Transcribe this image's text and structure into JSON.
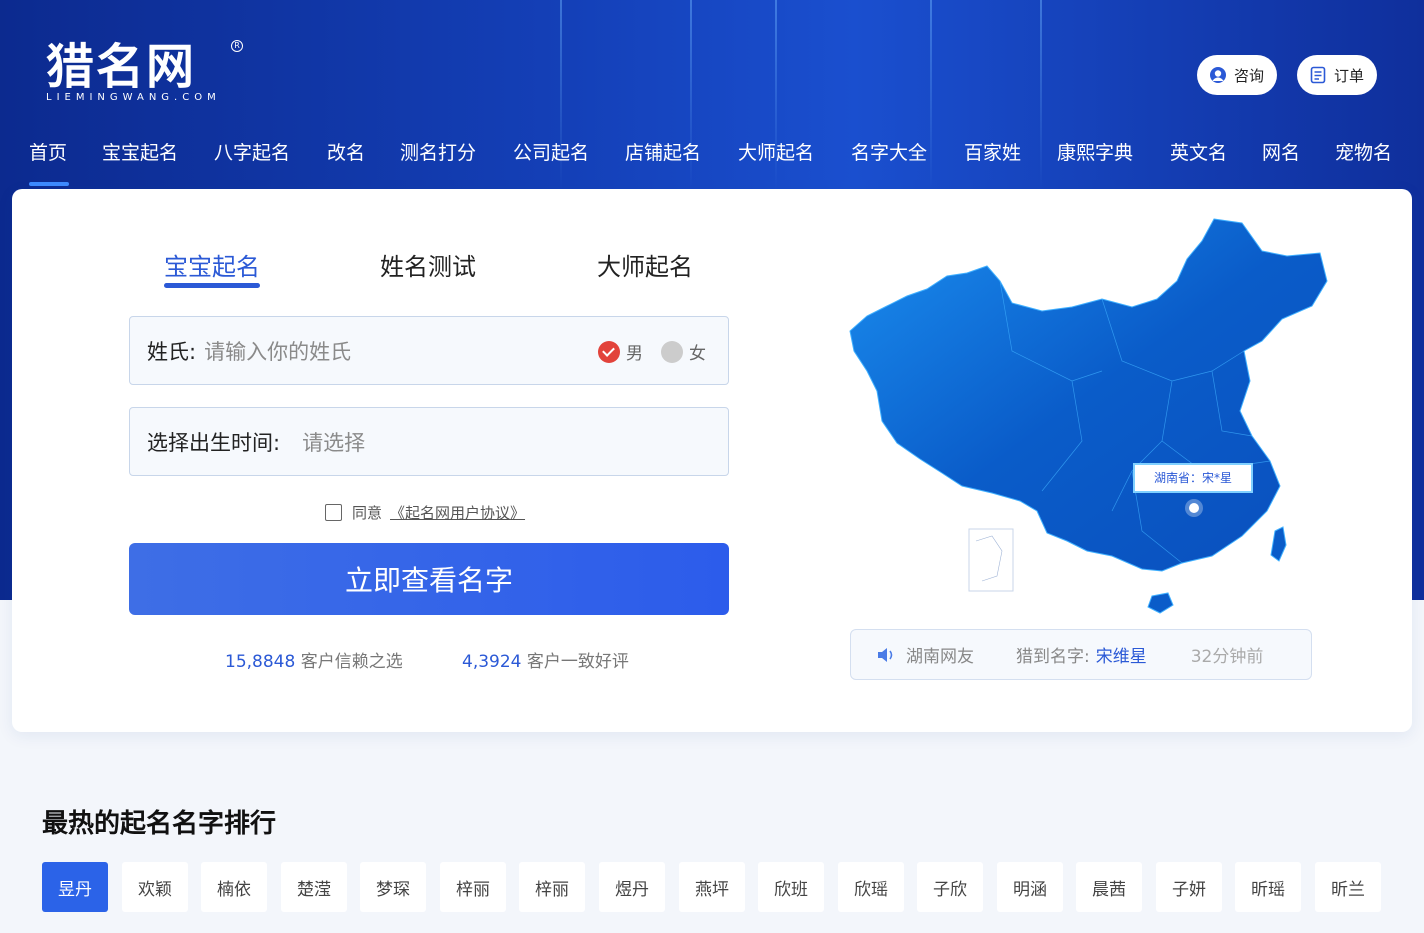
{
  "header": {
    "logo_text": "猎名网",
    "logo_sub": "LIEMINGWANG.COM",
    "consult_label": "咨询",
    "order_label": "订单"
  },
  "nav": {
    "items": [
      "首页",
      "宝宝起名",
      "八字起名",
      "改名",
      "测名打分",
      "公司起名",
      "店铺起名",
      "大师起名",
      "名字大全",
      "百家姓",
      "康熙字典",
      "英文名",
      "网名",
      "宠物名"
    ],
    "active": "首页"
  },
  "form": {
    "tabs": [
      "宝宝起名",
      "姓名测试",
      "大师起名"
    ],
    "active_tab": "宝宝起名",
    "surname_label": "姓氏:",
    "surname_placeholder": "请输入你的姓氏",
    "gender_male": "男",
    "gender_female": "女",
    "selected_gender": "男",
    "birth_label": "选择出生时间:",
    "birth_placeholder": "请选择",
    "agree_text": "同意",
    "agree_link": "《起名网用户协议》",
    "agreed": false,
    "submit_label": "立即查看名字",
    "stat1_num": "15,8848",
    "stat1_text": "客户信赖之选",
    "stat2_num": "4,3924",
    "stat2_text": "客户一致好评"
  },
  "map": {
    "popup": "湖南省：宋*星",
    "ticker_user": "湖南网友",
    "ticker_label": "猎到名字:",
    "ticker_name": "宋维星",
    "ticker_time": "32分钟前"
  },
  "ranking": {
    "title": "最热的起名名字排行",
    "names": [
      "昱丹",
      "欢颖",
      "楠依",
      "楚滢",
      "梦琛",
      "梓丽",
      "梓丽",
      "煜丹",
      "燕坪",
      "欣班",
      "欣瑶",
      "子欣",
      "明涵",
      "晨茜",
      "子妍",
      "昕瑶",
      "昕兰"
    ],
    "active": "昱丹"
  },
  "colors": {
    "primary": "#2b59d6",
    "hero_dark": "#0c2a8f",
    "accent_red": "#e2433b"
  }
}
